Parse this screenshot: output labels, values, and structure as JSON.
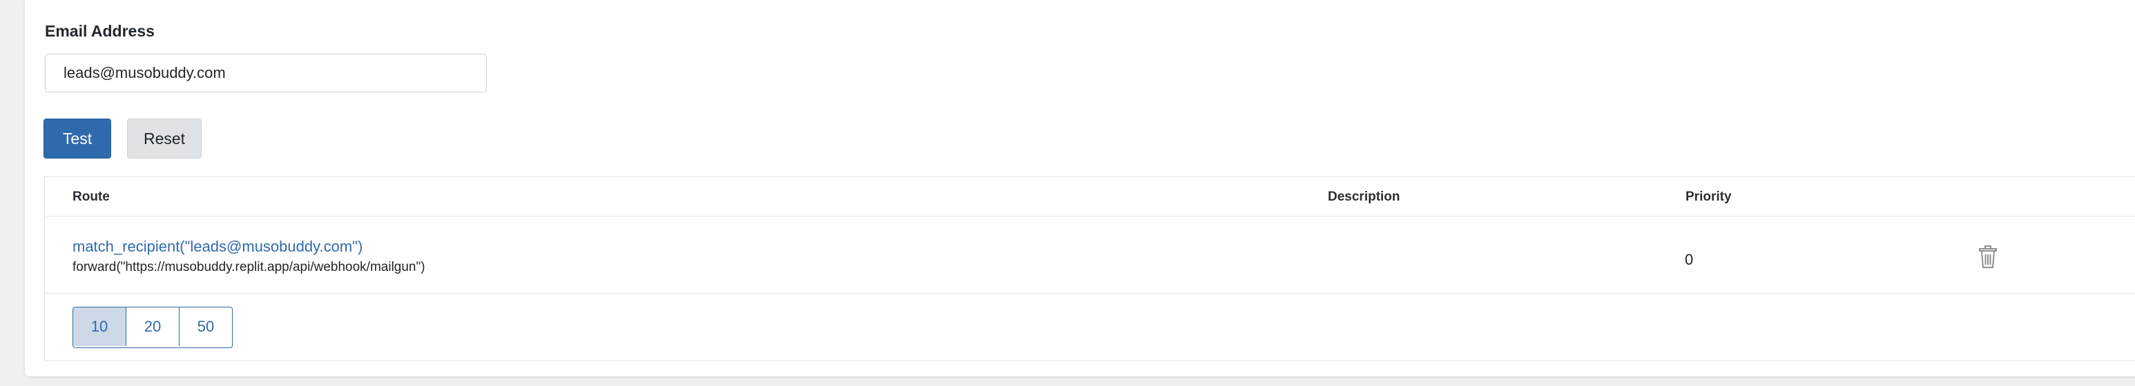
{
  "form": {
    "email_label": "Email Address",
    "email_value": "leads@musobuddy.com",
    "test_label": "Test",
    "reset_label": "Reset"
  },
  "table": {
    "headers": {
      "route": "Route",
      "description": "Description",
      "priority": "Priority"
    },
    "rows": [
      {
        "route": "match_recipient(\"leads@musobuddy.com\")",
        "action": "forward(\"https://musobuddy.replit.app/api/webhook/mailgun\")",
        "description": "",
        "priority": "0",
        "delete_icon": "trash-icon"
      }
    ]
  },
  "pagination": {
    "options": [
      "10",
      "20",
      "50"
    ],
    "selected": "10"
  },
  "colors": {
    "accent": "#2f6aad",
    "button_secondary": "#dfe3e6",
    "page_selected": "#cdd9e6"
  }
}
